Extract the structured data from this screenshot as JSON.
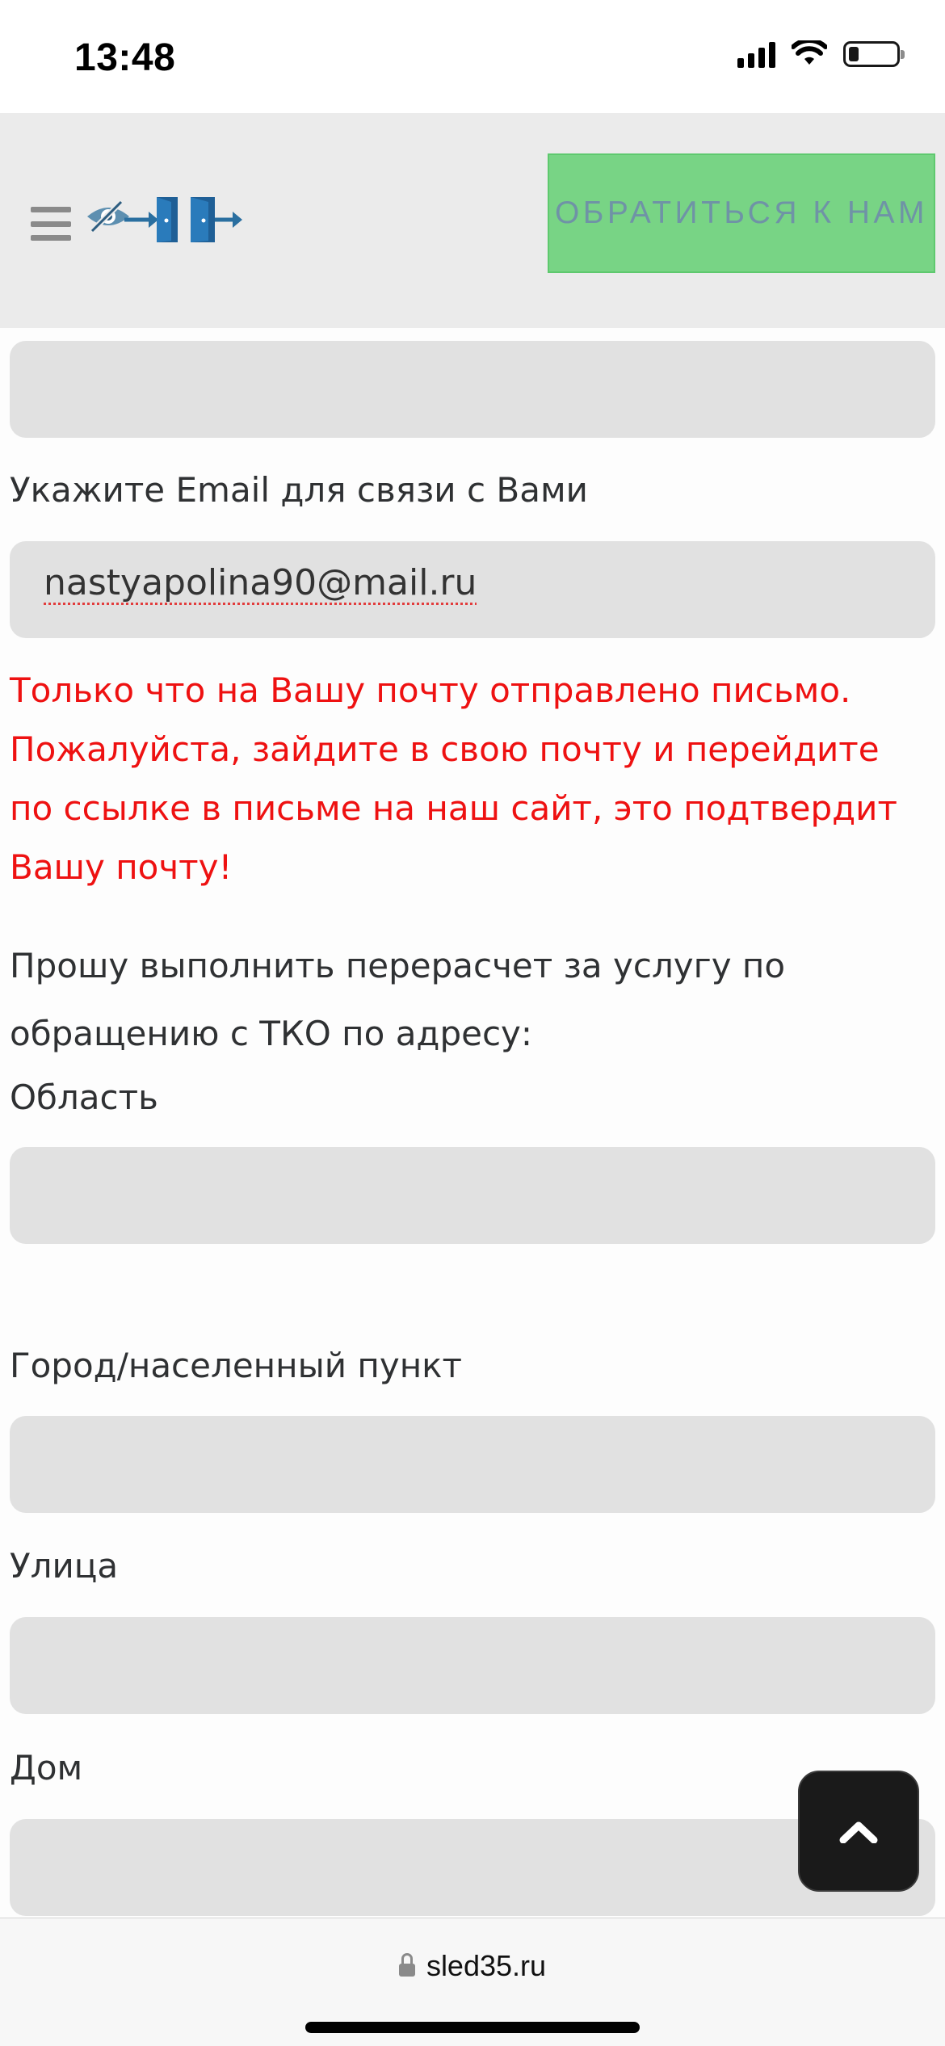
{
  "status_bar": {
    "time": "13:48"
  },
  "header": {
    "cta_label": "ОБРАТИТЬСЯ К НАМ"
  },
  "form": {
    "email_label": "Укажите Email для связи с Вами",
    "email_value": "nastyapolina90@mail.ru",
    "confirmation_message": "Только что на Вашу почту отправлено письмо. Пожалуйста, зайдите в свою почту и перейдите по ссылке в письме на наш сайт, это подтвердит Вашу почту!",
    "recalc_request": "Прошу выполнить перерасчет за услугу по обращению с ТКО по адресу:",
    "region_label": "Область",
    "city_label": "Город/населенный пункт",
    "street_label": "Улица",
    "house_label": "Дом"
  },
  "browser": {
    "url": "sled35.ru"
  },
  "colors": {
    "error": "#ee1111",
    "cta_bg": "#78d485",
    "field_bg": "#e1e1e1"
  },
  "icons": [
    "hamburger-menu-icon",
    "visually-impaired-eye-icon",
    "login-door-icon",
    "exit-door-icon",
    "chevron-up-icon",
    "lock-icon"
  ]
}
